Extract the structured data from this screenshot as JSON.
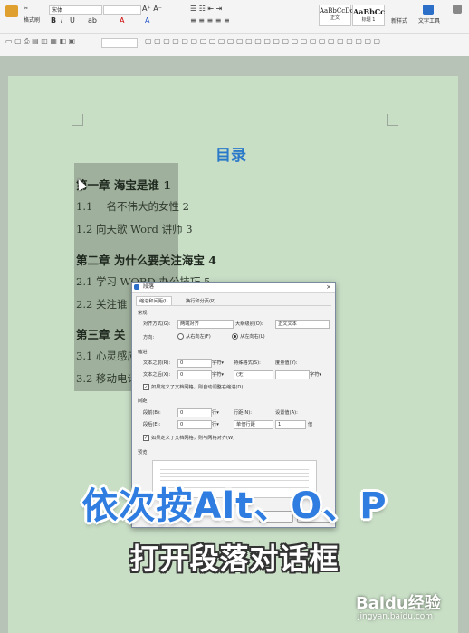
{
  "ribbon": {
    "font_name": "宋体",
    "font_size": "",
    "format_painter": "格式刷",
    "style_normal_preview": "AaBbCcDd",
    "style_normal_label": "正文",
    "style_h1_preview": "AaBbCc",
    "style_h1_label": "标题 1",
    "new_style": "新样式",
    "text_tools": "文字工具"
  },
  "document": {
    "toc_title": "目录",
    "entries": [
      {
        "text": "第一章  海宝是谁 1",
        "heading": true
      },
      {
        "text": "1.1 一名不伟大的女性 2",
        "heading": false
      },
      {
        "text": "1.2 向天歌 Word 讲师 3",
        "heading": false
      },
      {
        "text": "第二章  为什么要关注海宝 4",
        "heading": true
      },
      {
        "text": "2.1 学习 WORD 办公技巧 5",
        "heading": false
      },
      {
        "text": "2.2 关注谁",
        "heading": false
      },
      {
        "text": "第三章  关",
        "heading": true
      },
      {
        "text": "3.1 心灵感应",
        "heading": false
      },
      {
        "text": "3.2 移动电话",
        "heading": false
      }
    ]
  },
  "dialog": {
    "title": "段落",
    "close": "×",
    "tab_indent": "缩进和间距(I)",
    "tab_breaks": "换行和分页(P)",
    "general": "常规",
    "alignment_label": "对齐方式(G):",
    "alignment_value": "两端对齐",
    "outline_label": "大纲级别(O):",
    "outline_value": "正文文本",
    "direction_label": "方向:",
    "rtl": "从右向左(F)",
    "ltr": "从左向右(L)",
    "indent": "缩进",
    "before_text_label": "文本之前(R):",
    "before_text_value": "0",
    "after_text_label": "文本之后(X):",
    "after_text_value": "0",
    "unit_char": "字符▾",
    "special_label": "特殊格式(S):",
    "special_value": "(无)",
    "measure_label": "度量值(Y):",
    "grid_indent": "如果定义了文档网格，则自动调整右缩进(D)",
    "spacing": "间距",
    "before_label": "段前(B):",
    "before_value": "0",
    "after_label": "段后(E):",
    "after_value": "0",
    "unit_line": "行▾",
    "line_spacing_label": "行距(N):",
    "line_spacing_value": "单倍行距",
    "at_label": "设置值(A):",
    "at_value": "1",
    "at_unit": "倍",
    "grid_snap": "如果定义了文档网格，则与网格对齐(W)",
    "preview": "预览"
  },
  "captions": {
    "line1": "依次按Alt、O、P",
    "line2": "打开段落对话框"
  },
  "watermark": {
    "brand": "Baidu经验",
    "url": "jingyan.baidu.com"
  },
  "colors": {
    "page": "#c8dec5",
    "toc_title": "#2b79c9",
    "caption_blue": "#2f7de0"
  }
}
